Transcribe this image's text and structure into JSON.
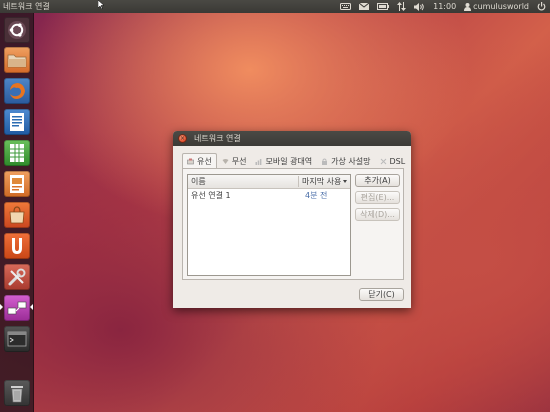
{
  "top_panel": {
    "app_title": "네트워크 연결",
    "clock": "11:00",
    "username": "cumulusworld",
    "indicator_icons": [
      "keyboard-icon",
      "mail-icon",
      "battery-icon",
      "network-transfer-icon",
      "volume-icon",
      "user-icon",
      "power-icon"
    ]
  },
  "launcher": {
    "items": [
      {
        "name": "dash-home",
        "icon": "ubuntu-logo-icon",
        "color": "#5a3a45"
      },
      {
        "name": "home-folder",
        "icon": "folder-icon",
        "color": "#e0803a"
      },
      {
        "name": "firefox",
        "icon": "firefox-icon",
        "color": "#3a6fb5"
      },
      {
        "name": "writer",
        "icon": "document-icon",
        "color": "#2c6cb3"
      },
      {
        "name": "calc",
        "icon": "spreadsheet-icon",
        "color": "#3d9a3a"
      },
      {
        "name": "impress",
        "icon": "presentation-icon",
        "color": "#d8742c"
      },
      {
        "name": "software-center",
        "icon": "shopping-bag-icon",
        "color": "#d9572a"
      },
      {
        "name": "ubuntu-one",
        "icon": "ubuntu-one-icon",
        "color": "#d94f1f"
      },
      {
        "name": "system-settings",
        "icon": "tools-icon",
        "color": "#c94a3a"
      },
      {
        "name": "network-connections",
        "icon": "network-icon",
        "color": "#b33aa8"
      },
      {
        "name": "terminal",
        "icon": "terminal-icon",
        "color": "#3a3a3a"
      },
      {
        "name": "trash",
        "icon": "trash-icon",
        "color": "#555"
      }
    ]
  },
  "dialog": {
    "title": "네트워크 연결",
    "tabs": [
      {
        "label": "유선",
        "active": true
      },
      {
        "label": "무선",
        "active": false
      },
      {
        "label": "모바일 광대역",
        "active": false
      },
      {
        "label": "가상 사설망",
        "active": false
      },
      {
        "label": "DSL",
        "active": false
      }
    ],
    "list": {
      "columns": {
        "name": "이름",
        "last_used": "마지막 사용"
      },
      "rows": [
        {
          "name": "유선 연결 1",
          "last_used": "4분 전"
        }
      ]
    },
    "buttons": {
      "add": "추가(A)",
      "edit": "편집(E)...",
      "delete": "삭제(D)...",
      "close": "닫기(C)"
    }
  }
}
